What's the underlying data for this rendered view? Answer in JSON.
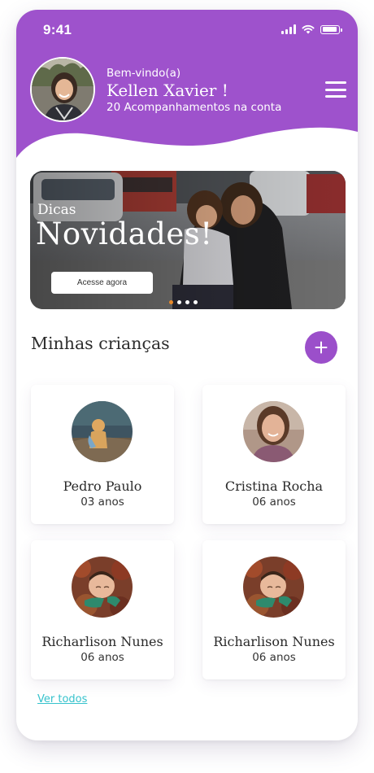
{
  "status_bar": {
    "time": "9:41"
  },
  "header": {
    "greeting": "Bem-vindo(a)",
    "user_name": "Kellen Xavier !",
    "follow_count": "20 Acompanhamentos na conta",
    "background_color": "#9e52cc"
  },
  "banner": {
    "kicker": "Dicas",
    "title": "Novidades!",
    "cta_label": "Acesse agora",
    "slide_count": 4,
    "active_slide": 1
  },
  "children_section": {
    "title": "Minhas crianças",
    "add_button_icon": "plus-icon",
    "accent_color": "#9b4fca",
    "items": [
      {
        "name": "Pedro Paulo",
        "age": "03 anos"
      },
      {
        "name": "Cristina Rocha",
        "age": "06 anos"
      },
      {
        "name": "Richarlison Nunes",
        "age": "06 anos"
      },
      {
        "name": "Richarlison Nunes",
        "age": "06 anos"
      }
    ],
    "see_all_label": "Ver todos",
    "link_color": "#35c2cc"
  }
}
